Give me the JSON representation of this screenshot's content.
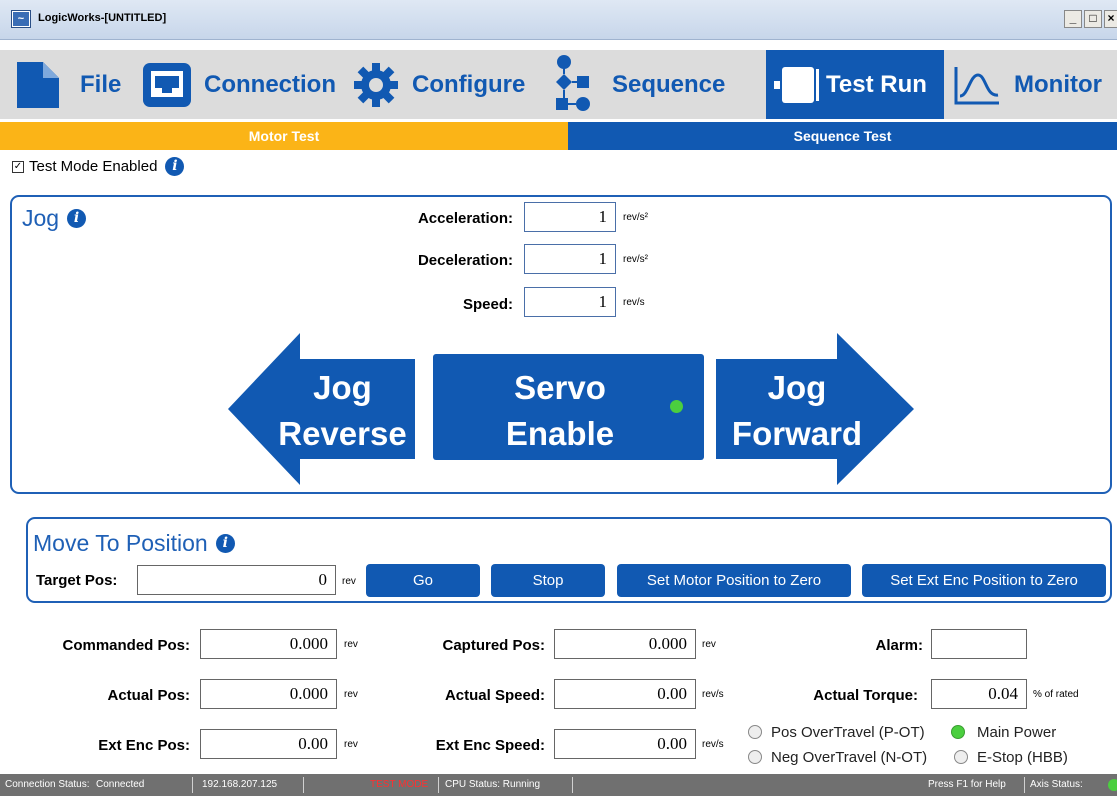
{
  "window": {
    "title": "LogicWorks-[UNTITLED]",
    "min": "_",
    "max": "□",
    "close": "×"
  },
  "tabs": [
    {
      "label": "File",
      "icon": "file-icon"
    },
    {
      "label": "Connection",
      "icon": "ethernet-port-icon"
    },
    {
      "label": "Configure",
      "icon": "gear-icon"
    },
    {
      "label": "Sequence",
      "icon": "sequence-flow-icon"
    },
    {
      "label": "Test Run",
      "icon": "motor-icon",
      "active": true
    },
    {
      "label": "Monitor",
      "icon": "waveform-icon"
    }
  ],
  "subtabs": {
    "motor_test": "Motor Test",
    "sequence_test": "Sequence Test",
    "colors": {
      "motor_test": "#fbb417",
      "sequence_test": "#1159b2"
    }
  },
  "test_mode": {
    "label": "Test Mode Enabled",
    "checked": true,
    "check": "☑"
  },
  "info_glyph": "i",
  "jog": {
    "title": "Jog",
    "acceleration": {
      "label": "Acceleration:",
      "value": "1",
      "unit": "rev/s²"
    },
    "deceleration": {
      "label": "Deceleration:",
      "value": "1",
      "unit": "rev/s²"
    },
    "speed": {
      "label": "Speed:",
      "value": "1",
      "unit": "rev/s"
    },
    "jog_reverse": {
      "line1": "Jog",
      "line2": "Reverse"
    },
    "servo_enable": {
      "line1": "Servo",
      "line2": "Enable",
      "indicator_color": "#4bcf3f"
    },
    "jog_forward": {
      "line1": "Jog",
      "line2": "Forward"
    }
  },
  "move_to_position": {
    "title": "Move To Position",
    "target_label": "Target Pos:",
    "target_value": "0",
    "target_unit": "rev",
    "go": "Go",
    "stop": "Stop",
    "set_motor_zero": "Set Motor Position to Zero",
    "set_ext_zero": "Set Ext Enc Position to Zero"
  },
  "readouts": {
    "commanded_pos": {
      "label": "Commanded Pos:",
      "value": "0.000",
      "unit": "rev"
    },
    "actual_pos": {
      "label": "Actual Pos:",
      "value": "0.000",
      "unit": "rev"
    },
    "ext_enc_pos": {
      "label": "Ext Enc Pos:",
      "value": "0.00",
      "unit": "rev"
    },
    "captured_pos": {
      "label": "Captured Pos:",
      "value": "0.000",
      "unit": "rev"
    },
    "actual_speed": {
      "label": "Actual Speed:",
      "value": "0.00",
      "unit": "rev/s"
    },
    "ext_enc_speed": {
      "label": "Ext Enc Speed:",
      "value": "0.00",
      "unit": "rev/s"
    },
    "alarm": {
      "label": "Alarm:",
      "value": ""
    },
    "actual_torque": {
      "label": "Actual Torque:",
      "value": "0.04",
      "unit": "% of rated"
    }
  },
  "indicators": {
    "pos_overtravel": {
      "label": "Pos OverTravel (P-OT)",
      "on": false
    },
    "neg_overtravel": {
      "label": "Neg OverTravel (N-OT)",
      "on": false
    },
    "main_power": {
      "label": "Main Power",
      "on": true
    },
    "estop": {
      "label": "E-Stop (HBB)",
      "on": false
    }
  },
  "statusbar": {
    "connection_label": "Connection Status:",
    "connection_value": "Connected",
    "ip": "192.168.207.125",
    "mode": "TEST MODE",
    "mode_color": "#ff3030",
    "cpu": "CPU Status: Running",
    "help": "Press F1 for Help",
    "axis": "Axis Status:"
  }
}
